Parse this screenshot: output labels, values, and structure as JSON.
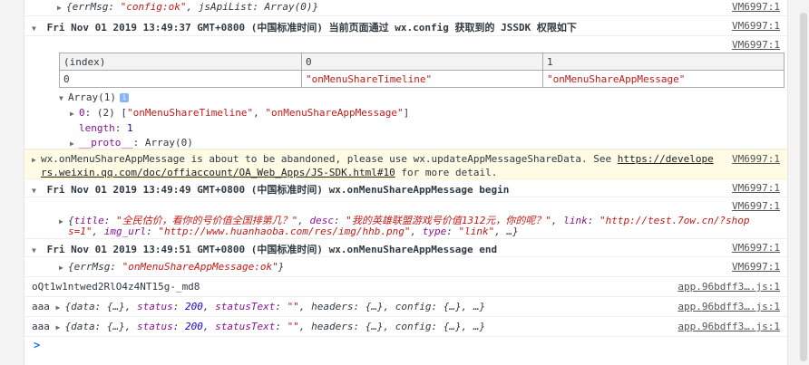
{
  "rows": {
    "r1": {
      "text_pre": "{errMsg: ",
      "val": "\"config:ok\"",
      "text_mid": ", jsApiList: Array(0)}",
      "src": "VM6997:1"
    },
    "r2": {
      "ts": "Fri Nov 01 2019 13:49:37 GMT+0800 (中国标准时间)",
      "msg": "当前页面通过 wx.config 获取到的 JSSDK 权限如下",
      "src": "VM6997:1"
    },
    "r3": {
      "src": "VM6997:1",
      "table": {
        "headers": [
          "(index)",
          "0",
          "1"
        ],
        "row": [
          "0",
          "\"onMenuShareTimeline\"",
          "\"onMenuShareAppMessage\""
        ]
      },
      "array_head": "Array(1)",
      "item0_key": "0",
      "item0_pre": "(2) [",
      "item0_v1": "\"onMenuShareTimeline\"",
      "item0_sep": ", ",
      "item0_v2": "\"onMenuShareAppMessage\"",
      "item0_post": "]",
      "length_key": "length",
      "length_val": "1",
      "proto_key": "__proto__",
      "proto_val": "Array(0)"
    },
    "r4": {
      "line1": "wx.onMenuShareAppMessage is about to be abandoned, please use wx.updateAppMessageShareData. See ",
      "link1": "https://develope",
      "link2": "rs.weixin.qq.com/doc/offiaccount/OA_Web_Apps/JS-SDK.html#10",
      "tail": " for more detail.",
      "src": "VM6997:1"
    },
    "r5": {
      "ts": "Fri Nov 01 2019 13:49:49 GMT+0800 (中国标准时间)",
      "msg": "wx.onMenuShareAppMessage begin",
      "src": "VM6997:1"
    },
    "r6": {
      "src": "VM6997:1",
      "k_title": "title",
      "v_title": "\"全民估价，看你的号价值全国排第几？\"",
      "k_desc": "desc",
      "v_desc": "\"我的英雄联盟游戏号价值1312元，你的呢？\"",
      "k_link": "link",
      "v_link1": "\"http://test.7ow.cn/?shop",
      "v_link2": "s=1\"",
      "k_img": "img_url",
      "v_img": "\"http://www.huanhaoba.com/res/img/hhb.png\"",
      "k_type": "type",
      "v_type": "\"link\"",
      "tail": ", …}"
    },
    "r7": {
      "ts": "Fri Nov 01 2019 13:49:51 GMT+0800 (中国标准时间)",
      "msg": "wx.onMenuShareAppMessage end",
      "src": "VM6997:1"
    },
    "r8": {
      "pre": "{errMsg: ",
      "val": "\"onMenuShareAppMessage:ok\"",
      "post": "}",
      "src": "VM6997:1"
    },
    "r9": {
      "text": "oQt1w1ntwed2RlO4z4NT15g-_md8",
      "src": "app.96bdff3….js:1"
    },
    "r10": {
      "label": "aaa",
      "p1": "{data: {…}, ",
      "k_status": "status",
      "v_status": "200",
      "k_st": "statusText",
      "v_st": "\"\"",
      "rest": ", headers: {…}, config: {…}, …}",
      "src": "app.96bdff3….js:1"
    },
    "r11": {
      "label": "aaa",
      "p1": "{data: {…}, ",
      "k_status": "status",
      "v_status": "200",
      "k_st": "statusText",
      "v_st": "\"\"",
      "rest": ", headers: {…}, config: {…}, …}",
      "src": "app.96bdff3….js:1"
    }
  },
  "prompt": ">"
}
